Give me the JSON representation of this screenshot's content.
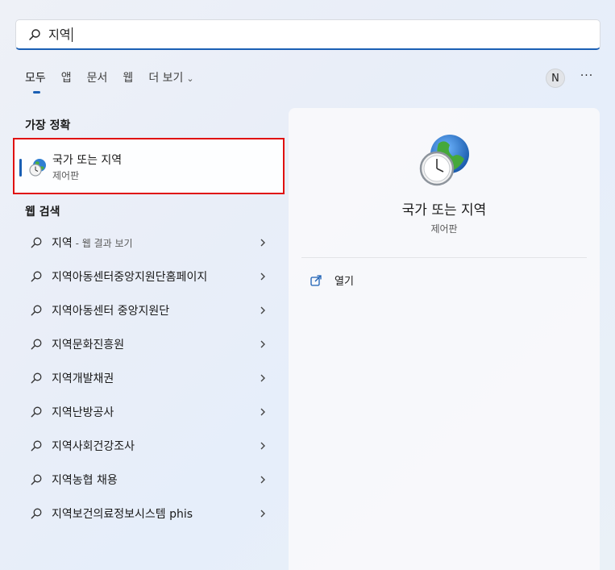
{
  "search": {
    "query": "지역",
    "icon": "search-icon"
  },
  "tabs": [
    {
      "label": "모두",
      "active": true
    },
    {
      "label": "앱"
    },
    {
      "label": "문서"
    },
    {
      "label": "웹"
    },
    {
      "label": "더 보기"
    }
  ],
  "header": {
    "avatar_letter": "N",
    "more_label": "···"
  },
  "best_match": {
    "section_title": "가장 정확",
    "name": "국가 또는 지역",
    "subtitle": "제어판",
    "icon": "globe-clock-icon"
  },
  "web_search": {
    "section_title": "웹 검색",
    "items": [
      {
        "label": "지역",
        "suffix": " - 웹 결과 보기"
      },
      {
        "label": "지역아동센터중앙지원단홈페이지"
      },
      {
        "label": "지역아동센터 중앙지원단"
      },
      {
        "label": "지역문화진흥원"
      },
      {
        "label": "지역개발채권"
      },
      {
        "label": "지역난방공사"
      },
      {
        "label": "지역사회건강조사"
      },
      {
        "label": "지역농협 채용"
      },
      {
        "label": "지역보건의료정보시스템 phis"
      }
    ]
  },
  "detail": {
    "title": "국가 또는 지역",
    "subtitle": "제어판",
    "actions": [
      {
        "label": "열기",
        "icon": "open-external-icon"
      }
    ]
  },
  "colors": {
    "accent": "#1a5fb4",
    "highlight_border": "#e01010"
  }
}
